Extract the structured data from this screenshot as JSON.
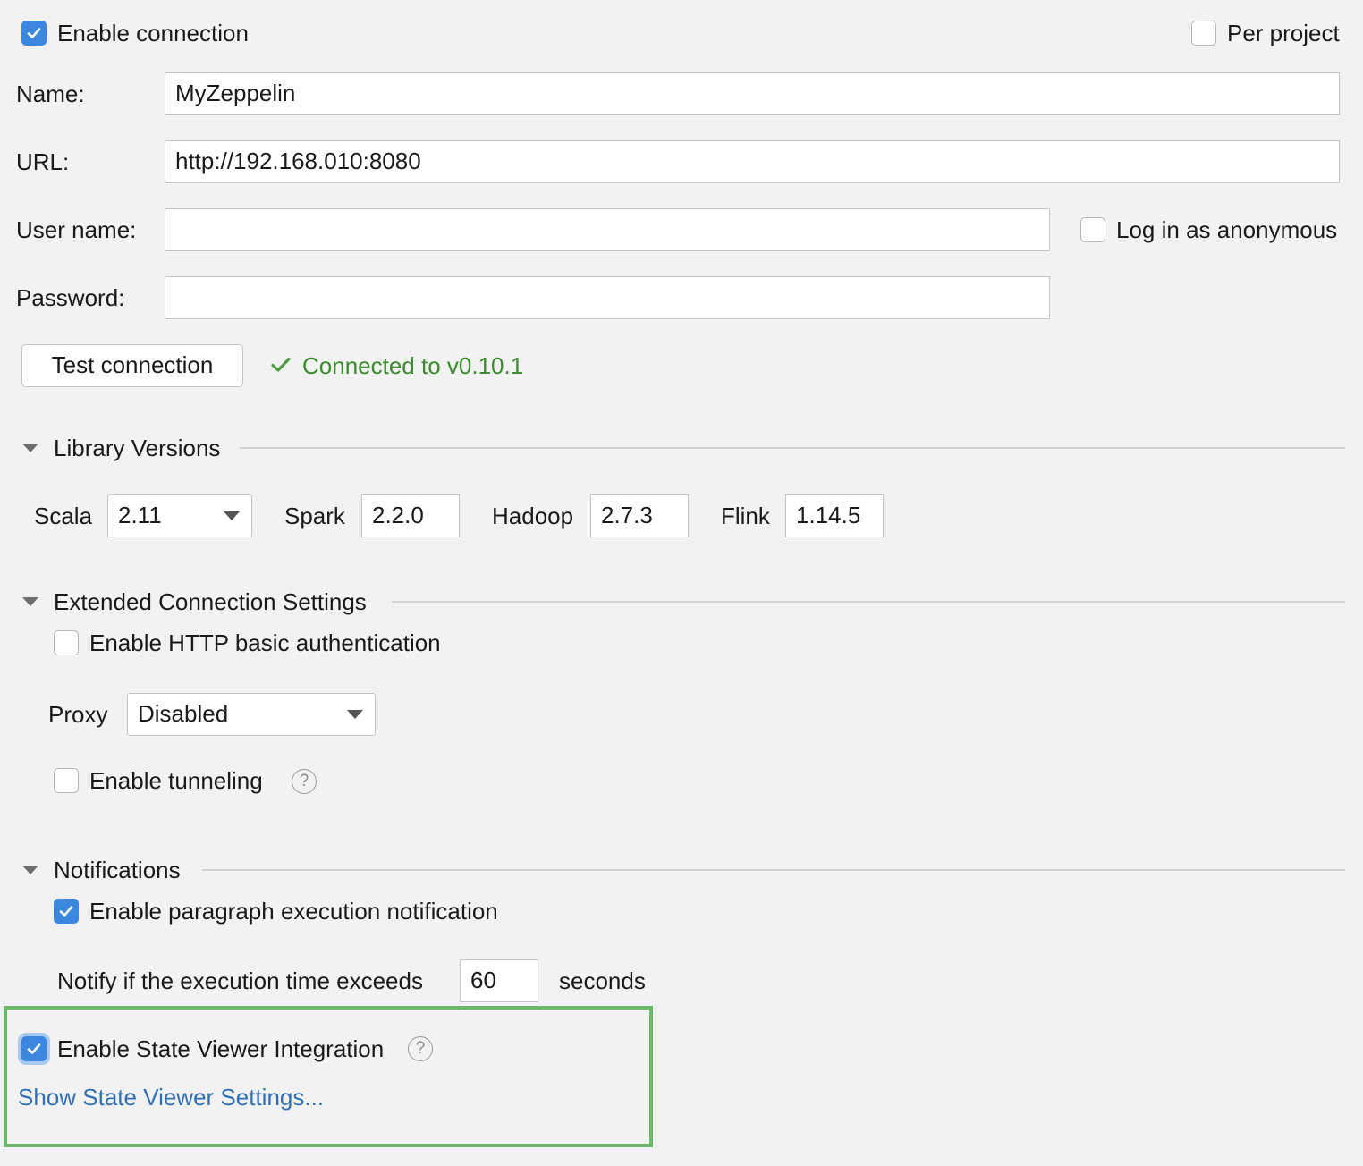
{
  "connection": {
    "enable_label": "Enable connection",
    "enable_checked": true,
    "per_project_label": "Per project",
    "per_project_checked": false
  },
  "form": {
    "name_label": "Name:",
    "name_value": "MyZeppelin",
    "url_label": "URL:",
    "url_value": "http://192.168.010:8080",
    "username_label": "User name:",
    "username_value": "",
    "password_label": "Password:",
    "password_value": "",
    "anonymous_label": "Log in as anonymous",
    "anonymous_checked": false
  },
  "test": {
    "button_label": "Test connection",
    "status_text": "Connected to v0.10.1",
    "status_color": "#3a8a2e"
  },
  "library_versions": {
    "title": "Library Versions",
    "scala_label": "Scala",
    "scala_value": "2.11",
    "spark_label": "Spark",
    "spark_value": "2.2.0",
    "hadoop_label": "Hadoop",
    "hadoop_value": "2.7.3",
    "flink_label": "Flink",
    "flink_value": "1.14.5"
  },
  "extended": {
    "title": "Extended Connection Settings",
    "http_auth_label": "Enable HTTP basic authentication",
    "http_auth_checked": false,
    "proxy_label": "Proxy",
    "proxy_value": "Disabled",
    "tunneling_label": "Enable tunneling",
    "tunneling_checked": false
  },
  "notifications": {
    "title": "Notifications",
    "paragraph_label": "Enable paragraph execution notification",
    "paragraph_checked": true,
    "notify_label": "Notify if the execution time exceeds",
    "notify_value": "60",
    "seconds_label": "seconds"
  },
  "state_viewer": {
    "enable_label": "Enable State Viewer Integration",
    "enable_checked": true,
    "settings_link": "Show State Viewer Settings...",
    "highlight_color": "#6ab868",
    "link_color": "#2f6fb5"
  },
  "colors": {
    "background": "#f2f2f2",
    "checkbox_accent": "#3b87e0"
  }
}
